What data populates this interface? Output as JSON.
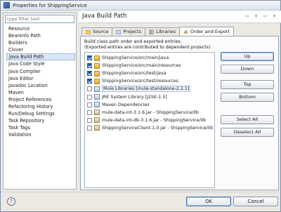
{
  "window": {
    "title": "Properties for ShippingService"
  },
  "sidebar": {
    "filter_placeholder": "type filter text",
    "items": [
      "Resource",
      "BeanInfo Path",
      "Builders",
      "Clover",
      "Java Build Path",
      "Java Code Style",
      "Java Compiler",
      "Java Editor",
      "Javadoc Location",
      "Maven",
      "Project References",
      "Refactoring History",
      "Run/Debug Settings",
      "Task Repository",
      "Task Tags",
      "Validation"
    ],
    "selected": "Java Build Path"
  },
  "header": {
    "title": "Java Build Path"
  },
  "tabs": [
    {
      "label": "Source",
      "icon": "source-folder-icon"
    },
    {
      "label": "Projects",
      "icon": "projects-icon"
    },
    {
      "label": "Libraries",
      "icon": "libraries-icon"
    },
    {
      "label": "Order and Export",
      "icon": "order-export-icon",
      "active": true
    }
  ],
  "panel": {
    "description_line1": "Build class path order and exported entries:",
    "description_line2": "(Exported entries are contributed to dependent projects)",
    "entries": [
      {
        "label": "ShippingService/src/main/java",
        "icon": "folder",
        "checked": true
      },
      {
        "label": "ShippingService/src/main/resources",
        "icon": "folder",
        "checked": true
      },
      {
        "label": "ShippingService/src/test/java",
        "icon": "folder",
        "checked": true
      },
      {
        "label": "ShippingService/src/test/resources",
        "icon": "folder",
        "checked": true
      },
      {
        "label": "Mule Libraries [mule-standalone-2.2.1]",
        "icon": "lib",
        "checked": false,
        "selected": true
      },
      {
        "label": "JRE System Library [J2SE-1.5]",
        "icon": "lib",
        "checked": false
      },
      {
        "label": "Maven Dependencies",
        "icon": "lib",
        "checked": false
      },
      {
        "label": "mule-data-int-3.1.6.jar - ShippingService/lib",
        "icon": "jar",
        "checked": false
      },
      {
        "label": "mule-data-int-db-3.1.6.jar - ShippingService/lib",
        "icon": "jar",
        "checked": false
      },
      {
        "label": "ShippingServiceClient-1.0.jar - ShippingService/lib",
        "icon": "jar",
        "checked": false
      }
    ],
    "buttons": {
      "up": "Up",
      "down": "Down",
      "top": "Top",
      "bottom": "Bottom",
      "select_all": "Select All",
      "deselect_all": "Deselect All"
    }
  },
  "footer": {
    "help_icon": "question-mark-icon",
    "ok": "OK",
    "cancel": "Cancel"
  },
  "nav": {
    "back_glyph": "⇦",
    "back_menu_glyph": "▾",
    "forward_glyph": "⇨",
    "forward_menu_glyph": "▾"
  }
}
